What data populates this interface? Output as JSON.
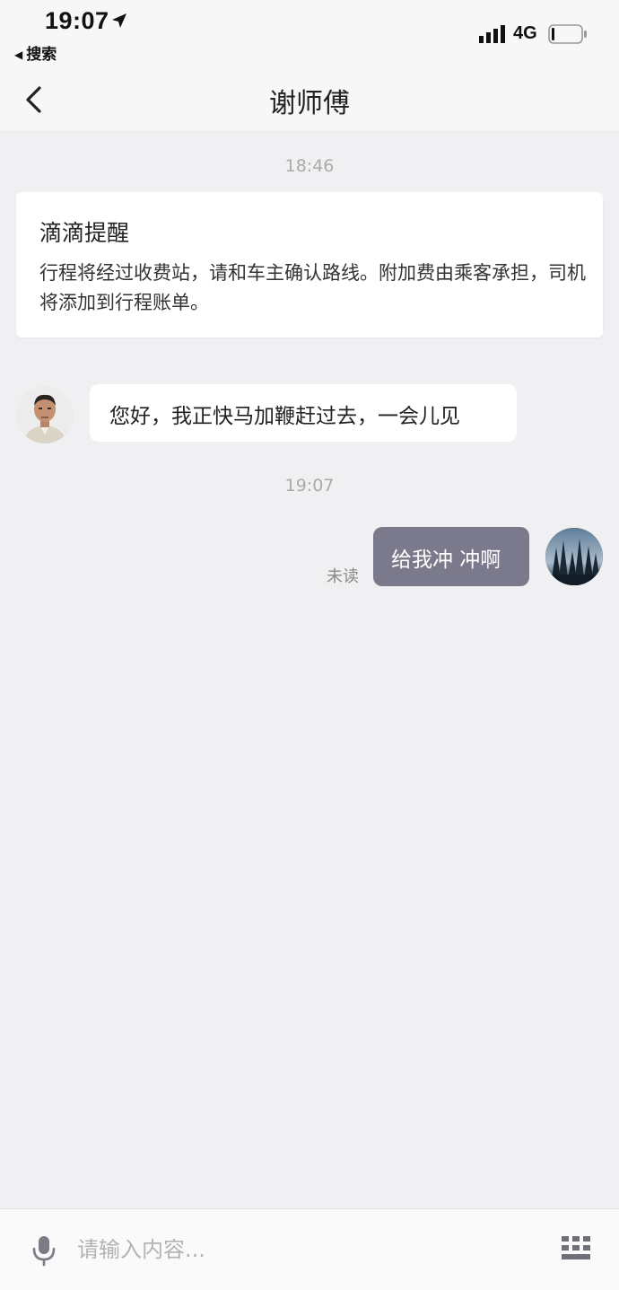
{
  "status_bar": {
    "time": "19:07",
    "back_app_label": "搜索",
    "network": "4G"
  },
  "nav": {
    "title": "谢师傅"
  },
  "messages": {
    "timestamp_1": "18:46",
    "notice": {
      "title": "滴滴提醒",
      "body": "行程将经过收费站，请和车主确认路线。附加费由乘客承担，司机将添加到行程账单。"
    },
    "driver_message": "您好，我正快马加鞭赶过去，一会儿见",
    "timestamp_2": "19:07",
    "my_message": "给我冲 冲啊",
    "my_message_status": "未读"
  },
  "input": {
    "placeholder": "请输入内容..."
  },
  "colors": {
    "background": "#f0f0f2",
    "outgoing_bubble": "#7b7a8c",
    "incoming_bubble": "#ffffff"
  },
  "icons": [
    "location-arrow-icon",
    "signal-icon",
    "battery-icon",
    "chevron-left-icon",
    "microphone-icon",
    "keyboard-icon"
  ]
}
